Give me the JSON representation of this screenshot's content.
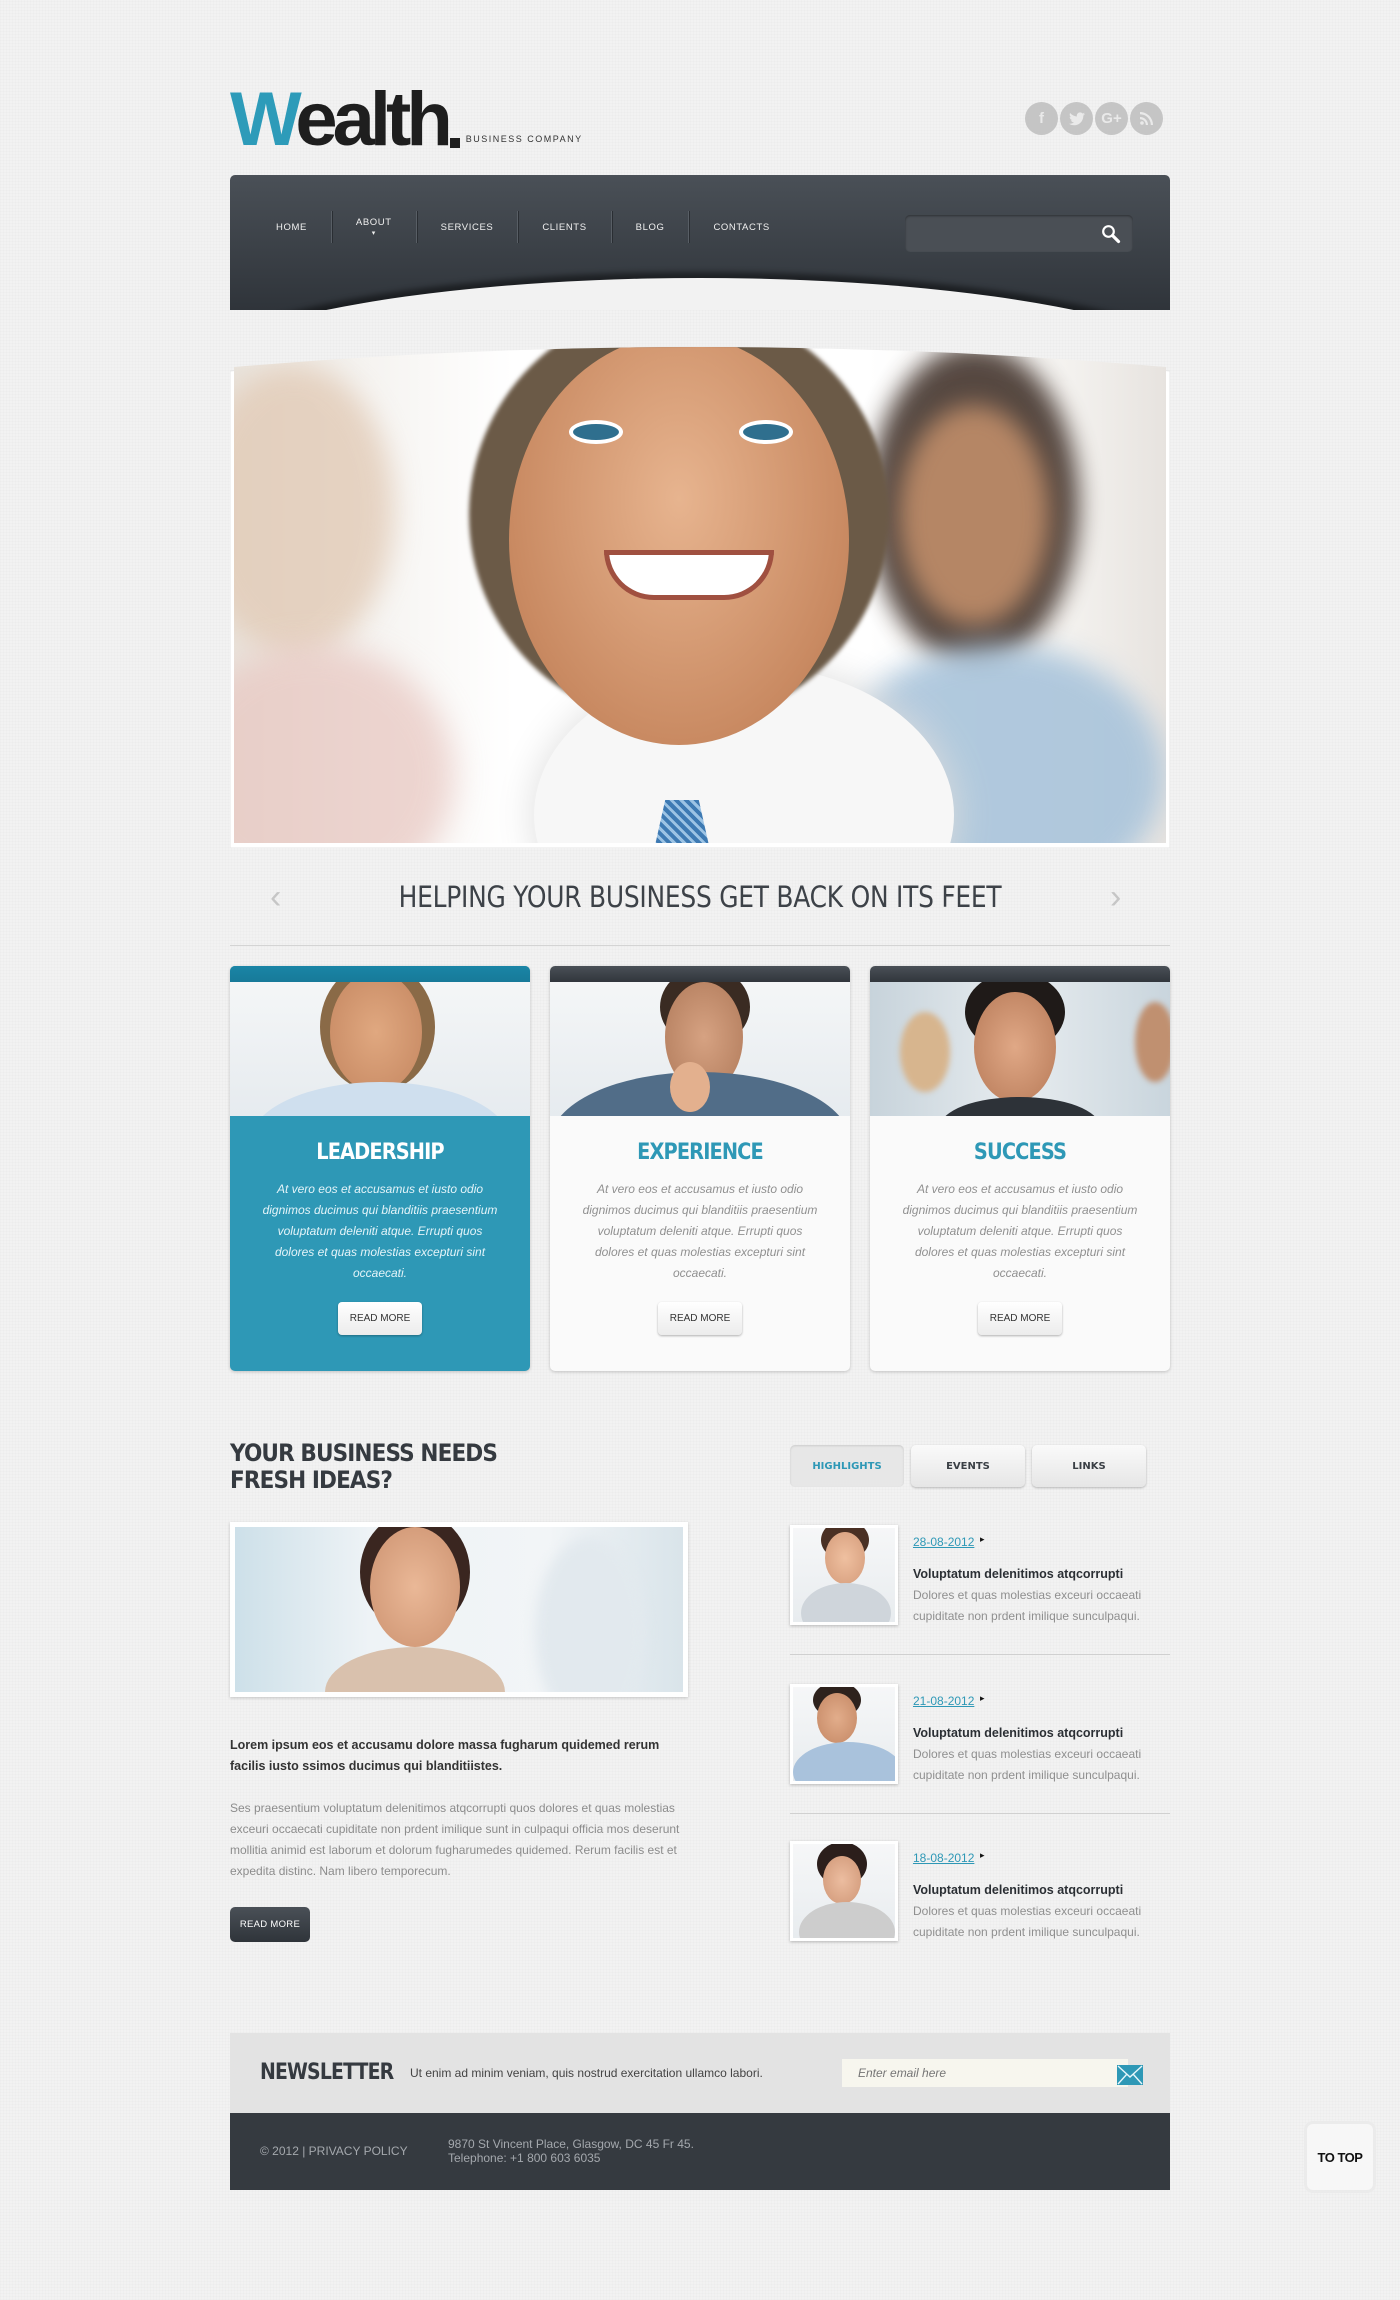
{
  "header": {
    "logo_first": "W",
    "logo_rest": "ealth",
    "tagline": "BUSINESS COMPANY",
    "social": [
      {
        "icon": "facebook-icon",
        "glyph": "f"
      },
      {
        "icon": "twitter-icon",
        "glyph": "t"
      },
      {
        "icon": "google-plus-icon",
        "glyph": "G+"
      },
      {
        "icon": "rss-icon",
        "glyph": "◔"
      }
    ]
  },
  "nav": {
    "items": [
      {
        "label": "HOME",
        "has_submenu": false
      },
      {
        "label": "ABOUT",
        "has_submenu": true
      },
      {
        "label": "SERVICES",
        "has_submenu": false
      },
      {
        "label": "CLIENTS",
        "has_submenu": false
      },
      {
        "label": "BLOG",
        "has_submenu": false
      },
      {
        "label": "CONTACTS",
        "has_submenu": false
      }
    ],
    "submenu_glyph": "▾",
    "search": {
      "value": "",
      "placeholder": ""
    }
  },
  "slider": {
    "caption": "HELPING YOUR BUSINESS GET BACK ON ITS FEET",
    "prev": "‹",
    "next": "›"
  },
  "cards": [
    {
      "title": "LEADERSHIP",
      "text": "At vero eos et accusamus et iusto odio dignimos ducimus qui blanditiis praesentium voluptatum deleniti atque. Errupti quos dolores et quas molestias excepturi sint occaecati.",
      "button": "READ MORE",
      "active": true
    },
    {
      "title": "EXPERIENCE",
      "text": "At vero eos et accusamus et iusto odio dignimos ducimus qui blanditiis praesentium voluptatum deleniti atque. Errupti quos dolores et quas molestias excepturi sint occaecati.",
      "button": "READ MORE",
      "active": false
    },
    {
      "title": "SUCCESS",
      "text": "At vero eos et accusamus et iusto odio dignimos ducimus qui blanditiis praesentium voluptatum deleniti atque. Errupti quos dolores et quas molestias excepturi sint occaecati.",
      "button": "READ MORE",
      "active": false
    }
  ],
  "ideas": {
    "heading_line1": "YOUR BUSINESS NEEDS",
    "heading_line2": "FRESH IDEAS?",
    "lead": "Lorem ipsum eos et accusamu dolore massa fugharum quidemed rerum facilis iusto ssimos ducimus qui blanditiistes.",
    "body": "Ses praesentium voluptatum delenitimos atqcorrupti quos dolores et quas molestias exceuri occaecati cupiditate non prdent imilique sunt in culpaqui officia mos deserunt mollitia animid est laborum et dolorum fugharumedes quidemed. Rerum facilis est et expedita distinc. Nam libero temporecum.",
    "button": "READ MORE"
  },
  "tabs": [
    {
      "label": "HIGHLIGHTS",
      "active": true
    },
    {
      "label": "EVENTS",
      "active": false
    },
    {
      "label": "LINKS",
      "active": false
    }
  ],
  "news": [
    {
      "date": "28-08-2012",
      "title": "Voluptatum delenitimos atqcorrupti",
      "text": "Dolores et quas molestias exceuri occaeati cupiditate non prdent imilique sunculpaqui."
    },
    {
      "date": "21-08-2012",
      "title": "Voluptatum delenitimos atqcorrupti",
      "text": "Dolores et quas molestias exceuri occaeati cupiditate non prdent imilique sunculpaqui."
    },
    {
      "date": "18-08-2012",
      "title": "Voluptatum delenitimos atqcorrupti",
      "text": "Dolores et quas molestias exceuri occaeati cupiditate non prdent imilique sunculpaqui."
    }
  ],
  "news_arrow": "▸",
  "newsletter": {
    "title": "NEWSLETTER",
    "text": "Ut enim ad minim veniam, quis nostrud exercitation ullamco labori.",
    "placeholder": "Enter email here"
  },
  "footer": {
    "copyright": "© 2012 | ",
    "privacy": "PRIVACY POLICY",
    "address": "9870 St Vincent Place, Glasgow, DC 45 Fr 45.",
    "telephone": "Telephone:  +1 800 603 6035"
  },
  "to_top": "TO TOP",
  "colors": {
    "accent": "#2e98b6",
    "dark": "#353a40",
    "background": "#f2f2f2"
  }
}
